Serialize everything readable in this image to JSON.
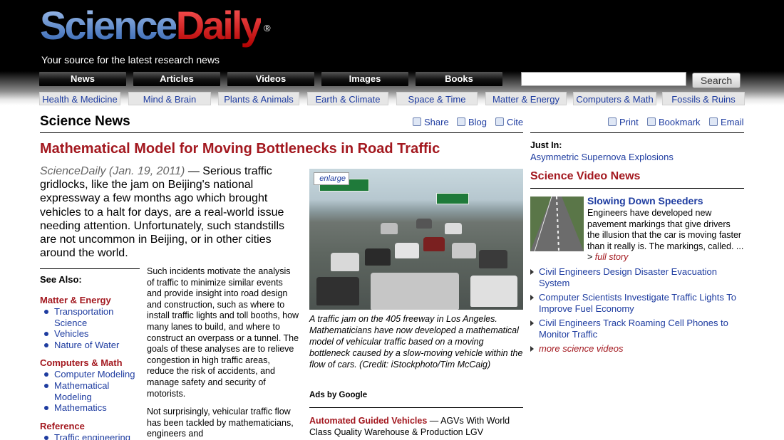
{
  "logo": {
    "science": "Science",
    "daily": "Daily",
    "reg": "®"
  },
  "tagline": "Your source for the latest research news",
  "nav": [
    "News",
    "Articles",
    "Videos",
    "Images",
    "Books"
  ],
  "search": {
    "value": "",
    "button": "Search"
  },
  "subnav": [
    "Health & Medicine",
    "Mind & Brain",
    "Plants & Animals",
    "Earth & Climate",
    "Space & Time",
    "Matter & Energy",
    "Computers & Math",
    "Fossils & Ruins"
  ],
  "section": {
    "title": "Science News"
  },
  "tools": {
    "share": "Share",
    "blog": "Blog",
    "cite": "Cite",
    "print": "Print",
    "bookmark": "Bookmark",
    "email": "Email"
  },
  "article": {
    "headline": "Mathematical Model for Moving Bottlenecks in Road Traffic",
    "source": "ScienceDaily (Jan. 19, 2011)",
    "lead": " — Serious traffic gridlocks, like the jam on Beijing's national expressway a few months ago which brought vehicles to a halt for days, are a real-world issue needing attention. Unfortunately, such standstills are not uncommon in Beijing, or in other cities around the world.",
    "para1": "Such incidents motivate the analysis of traffic to minimize similar events and provide insight into road design and construction, such as where to install traffic lights and toll booths, how many lanes to build, and where to construct an overpass or a tunnel. The goals of these analyses are to relieve congestion in high traffic areas, reduce the risk of accidents, and manage safety and security of motorists.",
    "para2": "Not surprisingly, vehicular traffic flow has been tackled by mathematicians, engineers and",
    "enlarge": "enlarge",
    "caption": "A traffic jam on the 405 freeway in Los Angeles. Mathematicians have now developed a mathematical model of vehicular traffic based on a moving bottleneck caused by a slow-moving vehicle within the flow of cars. (Credit: iStockphoto/Tim McCaig)"
  },
  "see_also": {
    "title": "See Also:",
    "groups": [
      {
        "name": "Matter & Energy",
        "items": [
          "Transportation Science",
          "Vehicles",
          "Nature of Water"
        ]
      },
      {
        "name": "Computers & Math",
        "items": [
          "Computer Modeling",
          "Mathematical Modeling",
          "Mathematics"
        ]
      },
      {
        "name": "Reference",
        "items": [
          "Traffic engineering"
        ]
      }
    ]
  },
  "ads": {
    "label": "Ads by Google",
    "title": "Automated Guided Vehicles",
    "text": " — AGVs With World Class Quality Warehouse & Production LGV"
  },
  "sidebar": {
    "just_in_label": "Just In:",
    "just_in_link": "Asymmetric Supernova Explosions",
    "video_section": "Science Video News",
    "video_title": "Slowing Down Speeders",
    "video_desc": "Engineers have developed new pavement markings that give drivers the illusion that the car is moving faster than it really is. The markings, called. ...",
    "video_more": "full story",
    "links": [
      "Civil Engineers Design Disaster Evacuation System",
      "Computer Scientists Investigate Traffic Lights To Improve Fuel Economy",
      "Civil Engineers Track Roaming Cell Phones to Monitor Traffic"
    ],
    "more_videos": "more science videos"
  }
}
